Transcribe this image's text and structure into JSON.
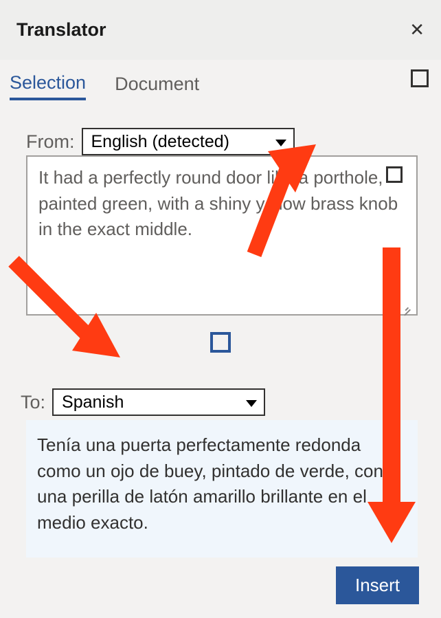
{
  "header": {
    "title": "Translator"
  },
  "tabs": {
    "selection": "Selection",
    "document": "Document"
  },
  "from": {
    "label": "From:",
    "value": "English (detected)"
  },
  "to": {
    "label": "To:",
    "value": "Spanish"
  },
  "source_text": "It had a perfectly round door like a porthole, painted green, with a shiny yellow brass knob in the exact middle.",
  "target_text": "Tenía una puerta perfectamente redonda como un ojo de buey, pintado de verde, con una perilla de latón amarillo brillante en el medio exacto.",
  "insert_label": "Insert"
}
